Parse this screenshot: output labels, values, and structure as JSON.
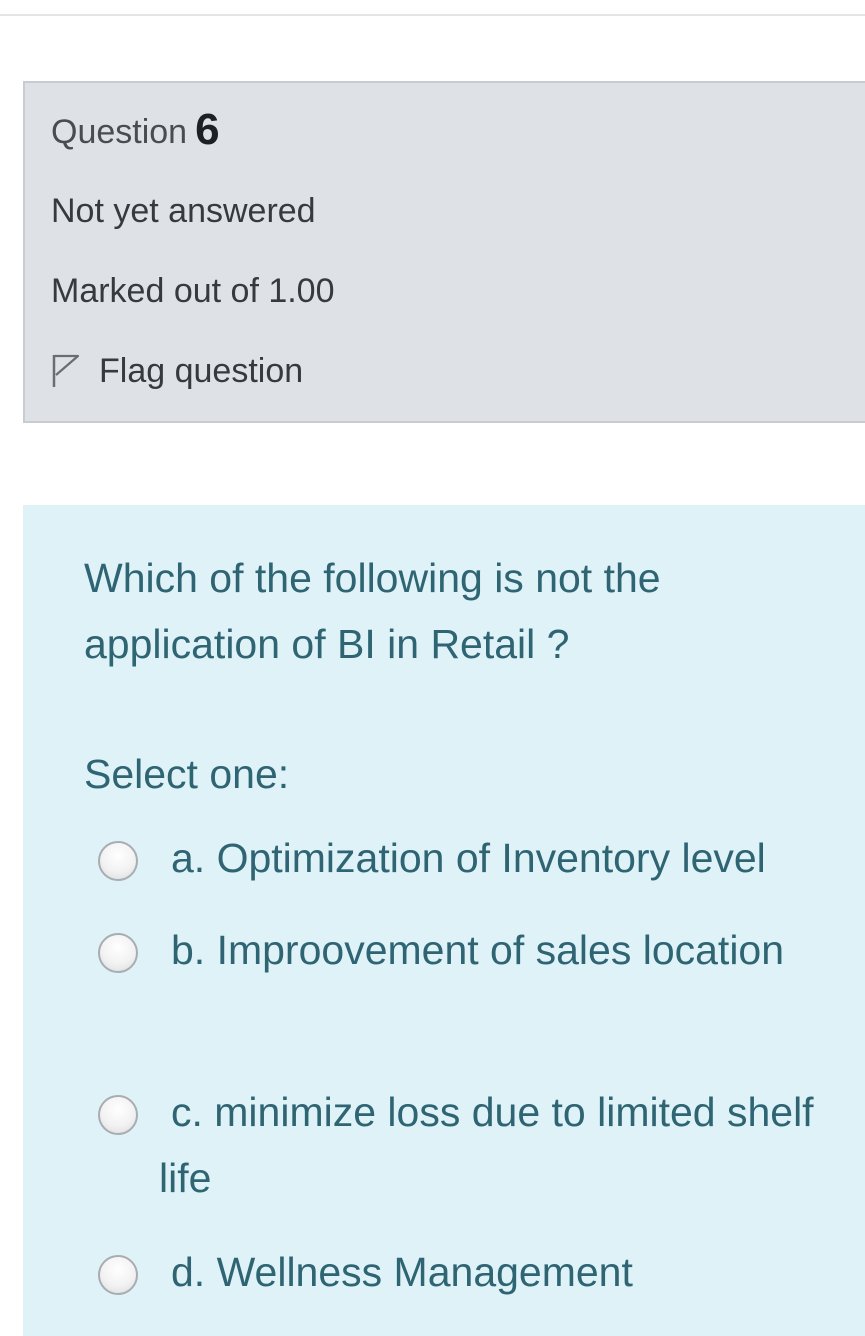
{
  "question": {
    "word": "Question",
    "number": "6",
    "state": "Not yet answered",
    "grade": "Marked out of 1.00",
    "flag_label": "Flag question",
    "text": "Which of the following is not the application of BI in Retail ?",
    "prompt": "Select one:",
    "answers": [
      {
        "label": "a. Optimization of Inventory level"
      },
      {
        "label": "b. Improovement of sales location"
      },
      {
        "label": "c. minimize loss due to limited shelf life"
      },
      {
        "label": "d. Wellness Management"
      }
    ]
  },
  "colors": {
    "info_bg": "#dee2e6",
    "content_bg": "#def2f8",
    "content_text": "#2f6473",
    "info_text": "#373a3c"
  },
  "icons": {
    "flag": "flag-outline-icon",
    "radio": "radio-unchecked"
  }
}
